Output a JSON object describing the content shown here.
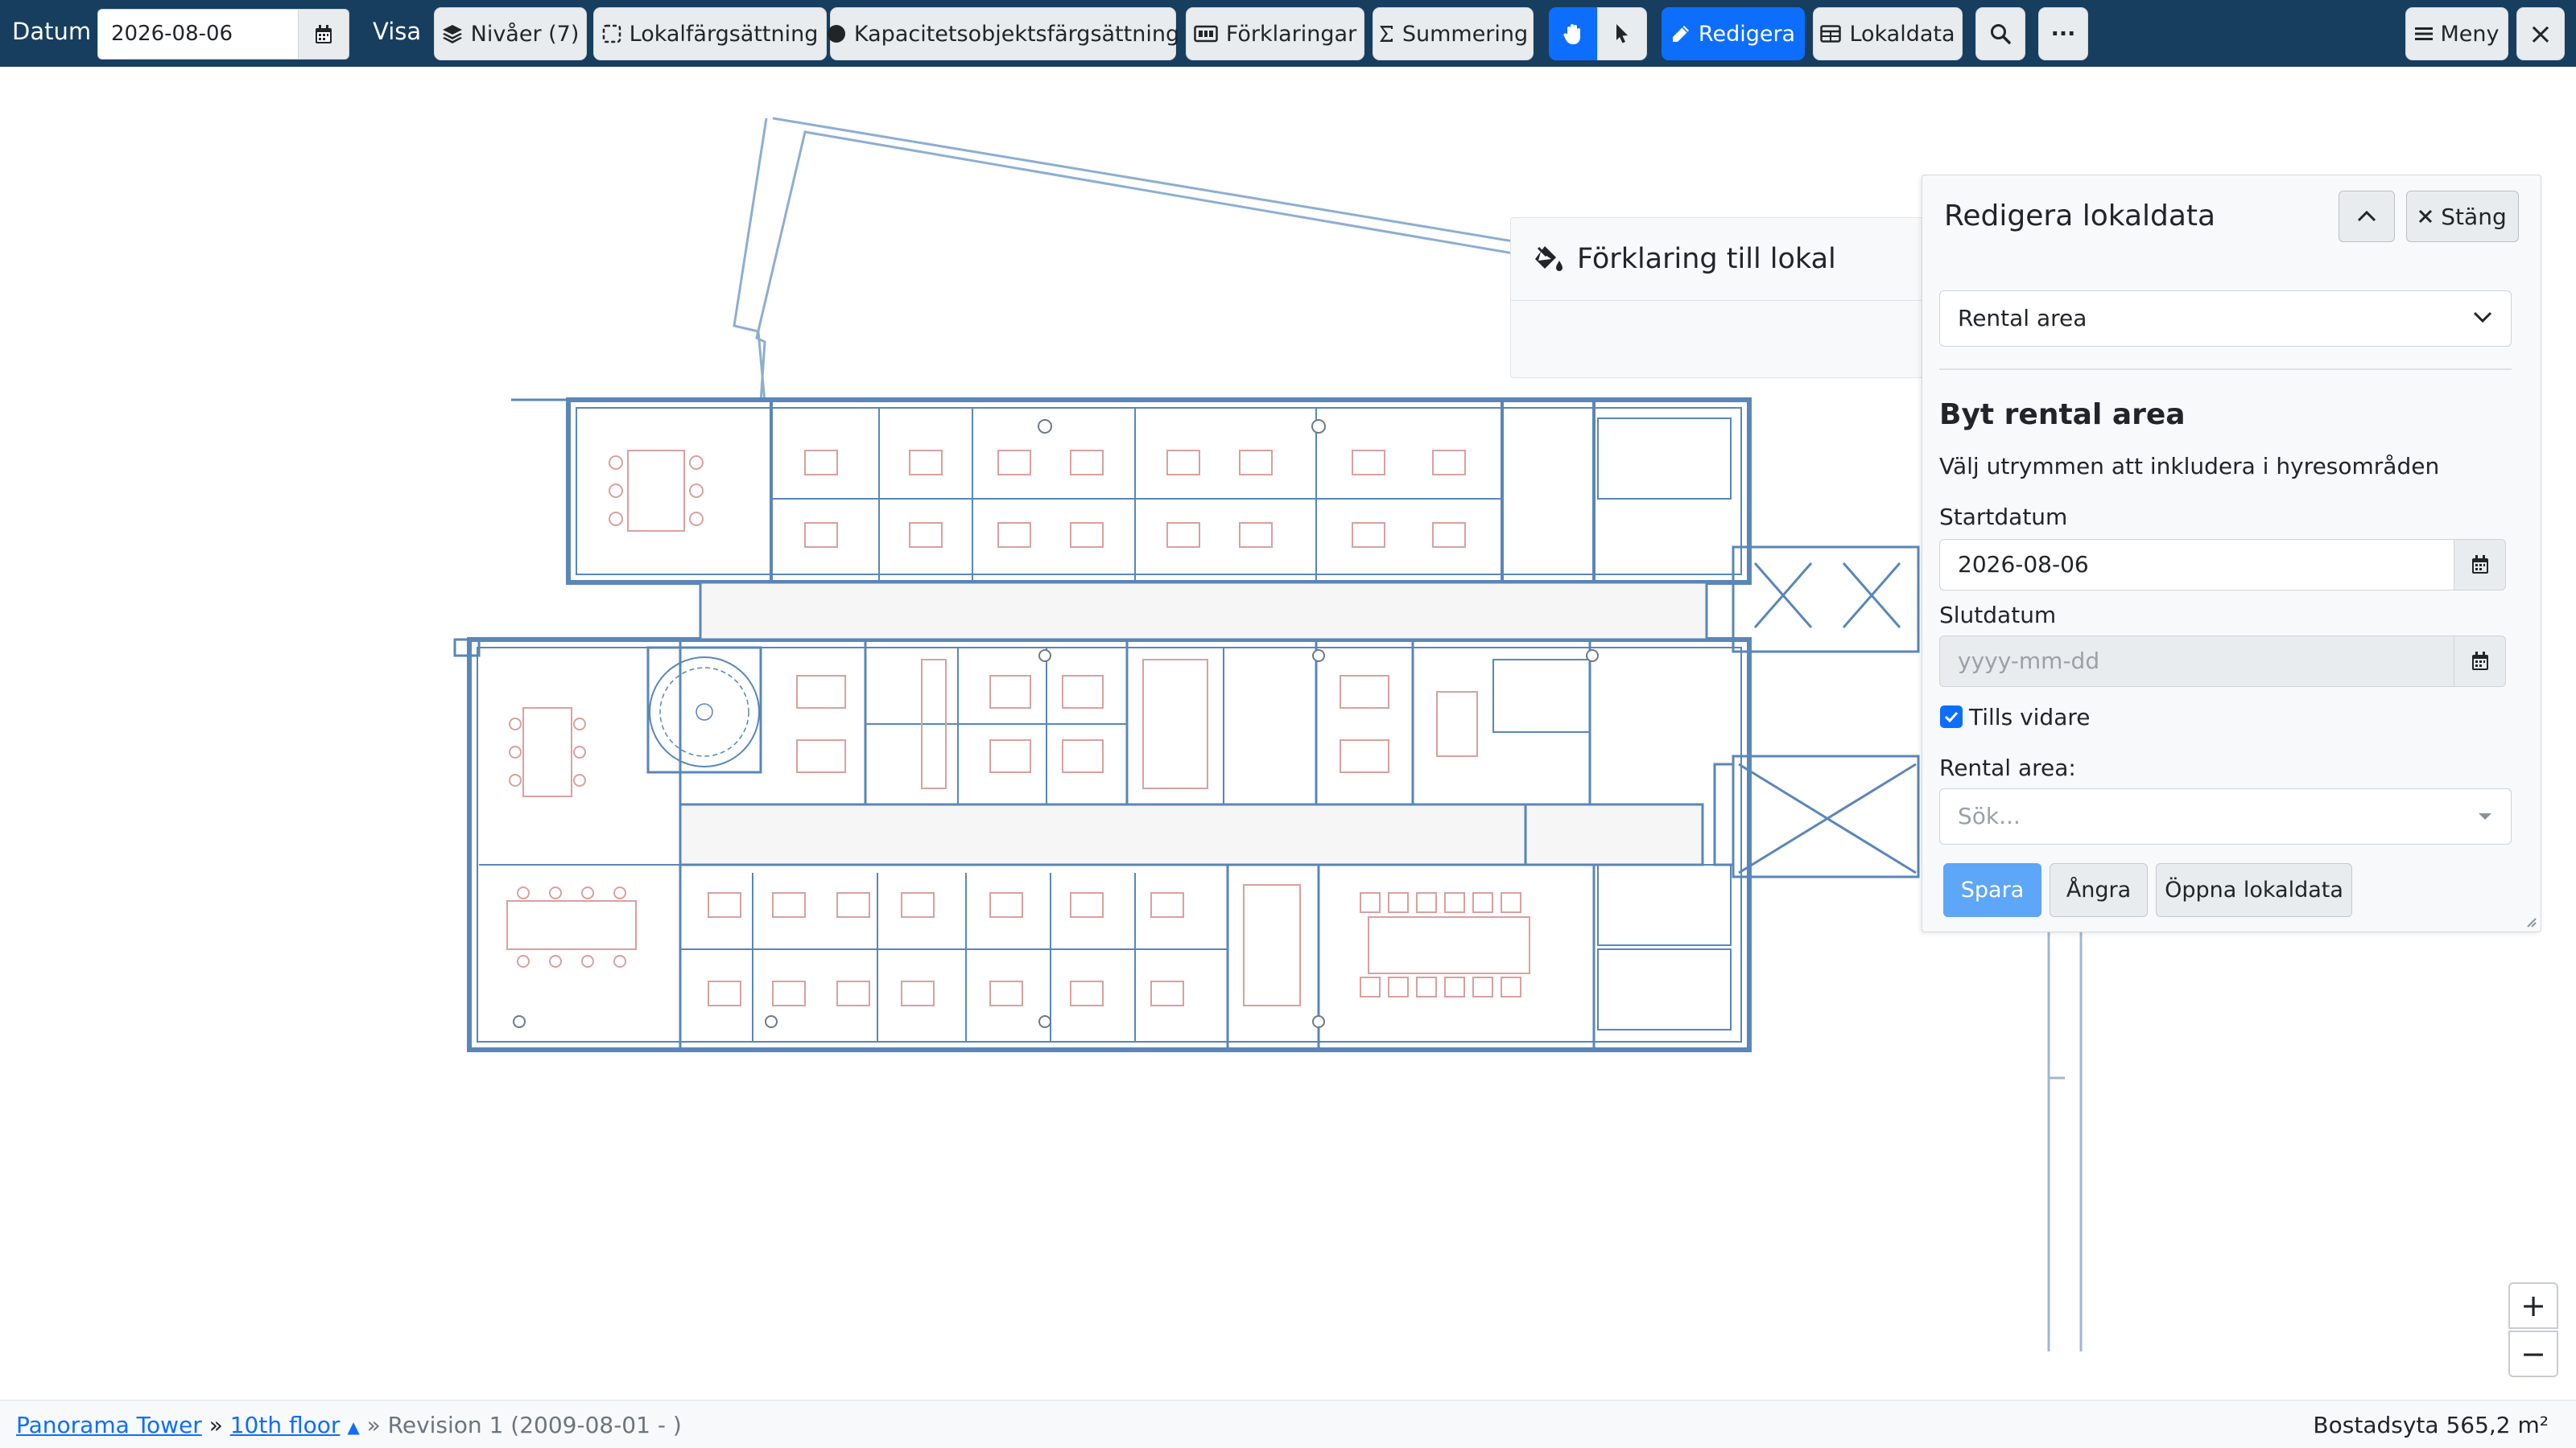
{
  "toolbar": {
    "date_label": "Datum",
    "date_value": "2026-08-06",
    "view_label": "Visa",
    "levels": "Nivåer (7)",
    "room_coloring": "Lokalfärgsättning",
    "capacity_coloring": "Kapacitetsobjektsfärgsättning",
    "legends": "Förklaringar",
    "summary": "Summering",
    "edit": "Redigera",
    "room_data": "Lokaldata",
    "more": "···",
    "menu": "Meny",
    "close": "×"
  },
  "legend_panel": {
    "title": "Förklaring till lokal"
  },
  "edit_panel": {
    "title": "Redigera lokaldata",
    "close_label": "Stäng",
    "category_select": "Rental area",
    "section_title": "Byt rental area",
    "instruction": "Välj utrymmen att inkludera i hyresområden",
    "start_label": "Startdatum",
    "start_value": "2026-08-06",
    "end_label": "Slutdatum",
    "end_placeholder": "yyyy-mm-dd",
    "until_further": "Tills vidare",
    "until_further_checked": true,
    "area_label": "Rental area:",
    "area_placeholder": "Sök...",
    "save": "Spara",
    "undo": "Ångra",
    "open_data": "Öppna lokaldata"
  },
  "zoom": {
    "in": "+",
    "out": "−"
  },
  "statusbar": {
    "building": "Panorama Tower",
    "sep1": "»",
    "floor": "10th floor",
    "floor_caret": "▲",
    "sep2": "»",
    "revision": "Revision 1 (2009-08-01 - )",
    "area": "Bostadsyta 565,2 m²"
  },
  "colors": {
    "toolbar_bg": "#173e5f",
    "primary": "#0d6efd",
    "plan_wall": "#5a86b8",
    "plan_furniture": "#d9a0a0"
  }
}
